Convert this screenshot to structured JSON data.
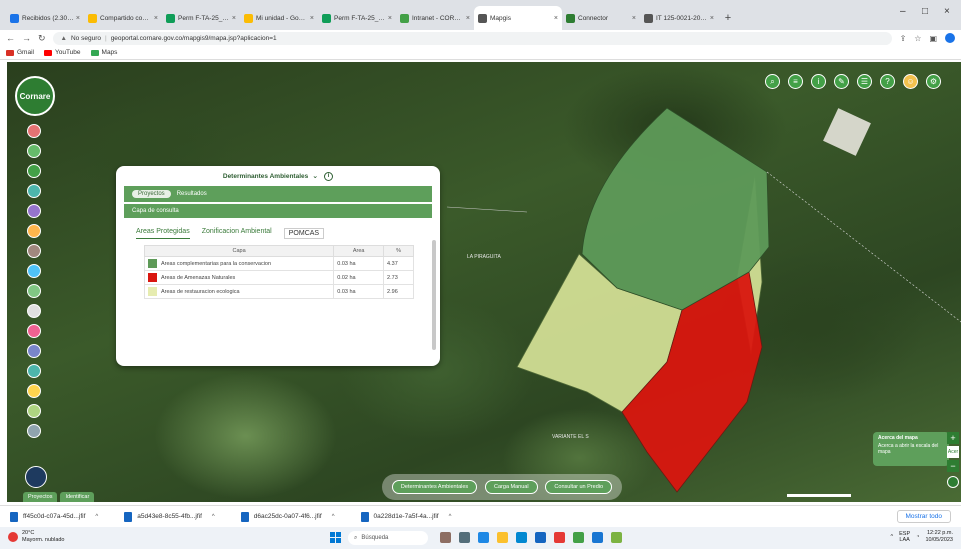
{
  "browser": {
    "tabs": [
      {
        "label": "Recibidos (2.300) - cor",
        "color": "#1a73e8"
      },
      {
        "label": "Compartido conmigo",
        "color": "#fbbc04"
      },
      {
        "label": "Perm F-TA-25_TRAM",
        "color": "#0f9d58"
      },
      {
        "label": "Mi unidad - Google D",
        "color": "#fbbc04"
      },
      {
        "label": "Perm F-TA-25_TRAM",
        "color": "#0f9d58"
      },
      {
        "label": "Intranet - CORNARE",
        "color": "#43a047"
      },
      {
        "label": "Mapgis",
        "color": "#555555",
        "active": true
      },
      {
        "label": "Connector",
        "color": "#2e7d32"
      },
      {
        "label": "IT 125-0021-2020 Ex",
        "color": "#555555"
      }
    ],
    "url_security": "No seguro",
    "url": "geoportal.cornare.gov.co/mapgis9/mapa.jsp?aplicacion=1",
    "bookmarks": [
      {
        "label": "Gmail",
        "color": "#d93025"
      },
      {
        "label": "YouTube",
        "color": "#ff0000"
      },
      {
        "label": "Maps",
        "color": "#34a853"
      }
    ]
  },
  "map": {
    "logo_text": "Cornare",
    "labels": [
      {
        "text": "LA PIRAGUITA"
      },
      {
        "text": "VARIANTE EL S"
      }
    ],
    "colors": {
      "complementary": "#5e9a58",
      "natural_threat": "#d9160f",
      "ecological_restoration": "#d9e69a"
    }
  },
  "panel": {
    "title": "Determinantes Ambientales",
    "top_pill": "Proyectos",
    "top_bar_text": "Resultados",
    "sub_bar_text": "Capa de consulta",
    "subtabs": [
      "Areas Protegidas",
      "Zonificacion Ambiental",
      "POMCAS"
    ],
    "table": {
      "headers": [
        "Capa",
        "Area",
        "%"
      ],
      "rows": [
        {
          "swatch": "#5e9a58",
          "name": "Areas complementarias para la conservacion",
          "area": "0.03 ha",
          "pct": "4.37"
        },
        {
          "swatch": "#d9160f",
          "name": "Areas de Amenazas Naturales",
          "area": "0.02 ha",
          "pct": "2.73"
        },
        {
          "swatch": "#e6ecb0",
          "name": "Areas de restauracion ecologica",
          "area": "0.03 ha",
          "pct": "2.96"
        }
      ]
    }
  },
  "bottom_buttons": [
    "Determinantes Ambientales",
    "Carga Manual",
    "Consultar un Predio"
  ],
  "map_tabs": [
    "Proyectos",
    "Identificar"
  ],
  "about_map": {
    "title": "Acerca del mapa",
    "text": "Acerca a abrir la escala del mapa"
  },
  "zoom_label": "Acer",
  "downloads": [
    "ff45c0d-c07a-45d...jfif",
    "a5d43e8-8c55-4fb...jfif",
    "d6ac25dc-0a07-4f6...jfif",
    "0a228d1e-7a5f-4a...jfif"
  ],
  "downloads_showall": "Mostrar todo",
  "taskbar": {
    "weather_temp": "20°C",
    "weather_text": "Mayorm. nublado",
    "search_placeholder": "Búsqueda",
    "lang": "ESP",
    "lang_sub": "LAA",
    "time": "12:22 p.m.",
    "date": "10/05/2023"
  }
}
